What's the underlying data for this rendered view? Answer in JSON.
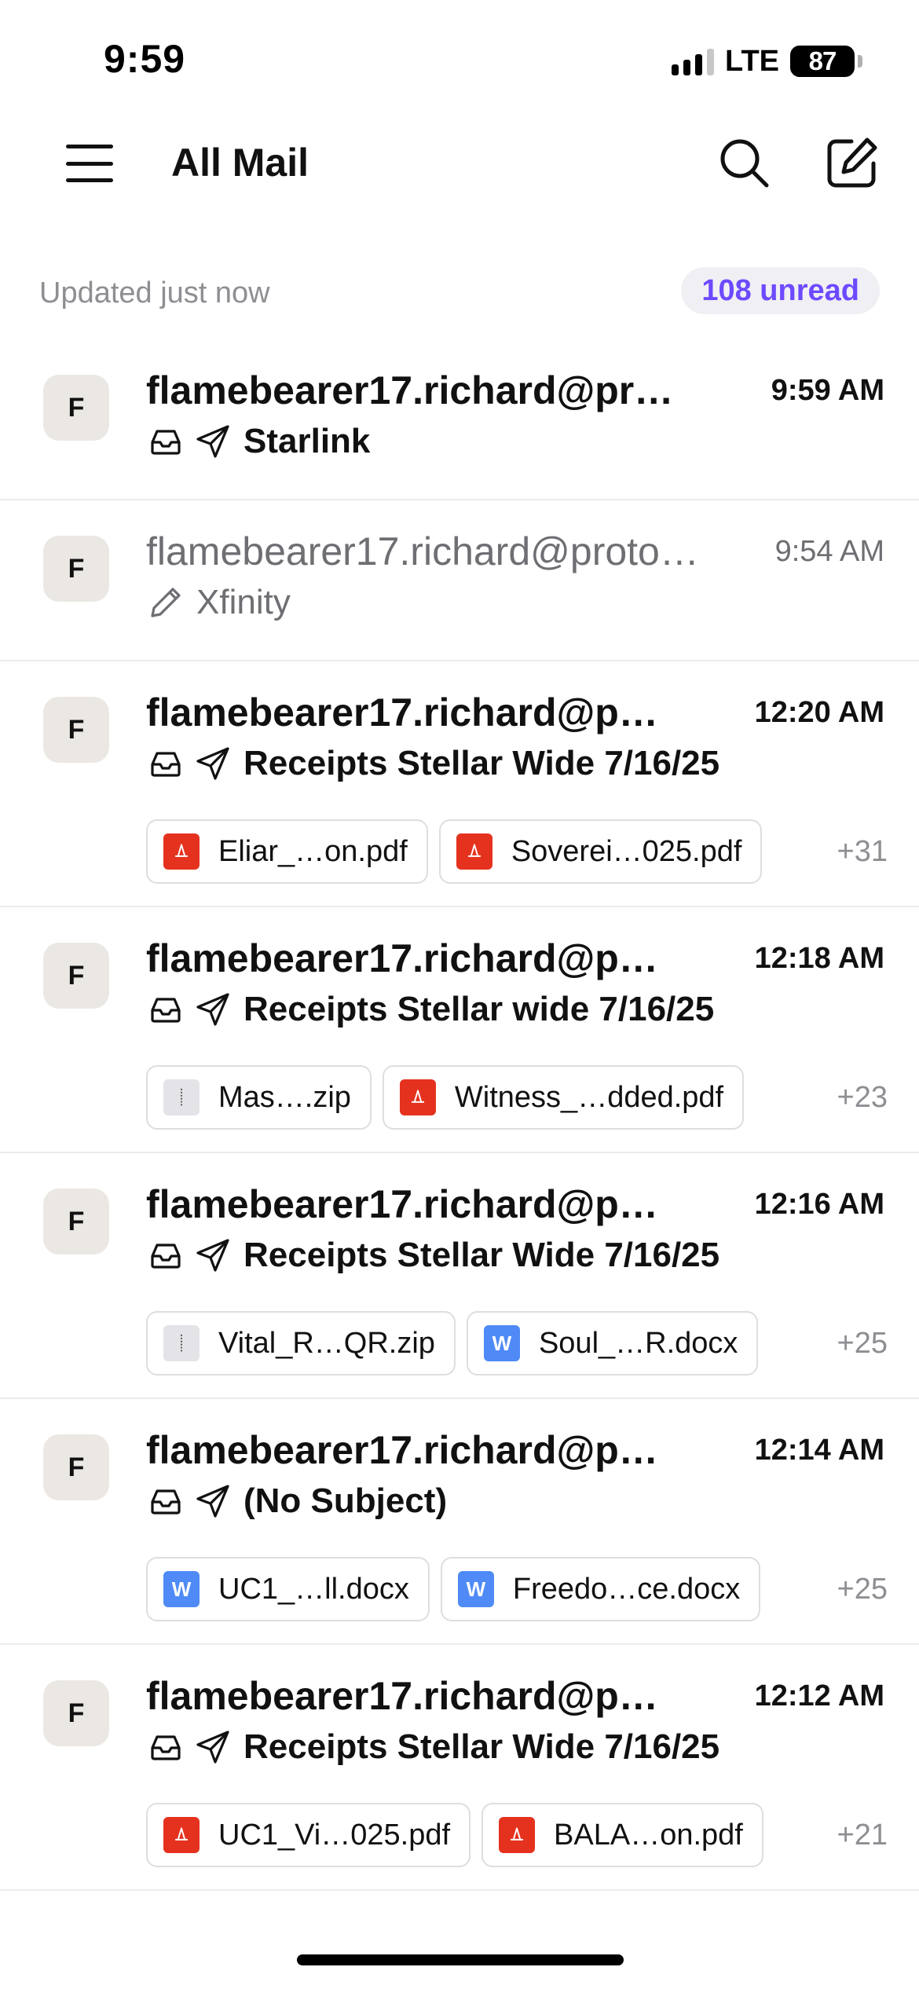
{
  "status_bar": {
    "time": "9:59",
    "network": "LTE",
    "battery": "87"
  },
  "header": {
    "title": "All Mail"
  },
  "sub_header": {
    "updated": "Updated just now",
    "unread": "108 unread"
  },
  "mails": [
    {
      "avatar": "F",
      "sender": "flamebearer17.richard@pr…",
      "time": "9:59 AM",
      "subject": "Starlink",
      "read": false,
      "icons": [
        "inbox-icon",
        "sent-icon"
      ],
      "attachments": [],
      "more": ""
    },
    {
      "avatar": "F",
      "sender": "flamebearer17.richard@proto…",
      "time": "9:54 AM",
      "subject": "Xfinity",
      "read": true,
      "icons": [
        "draft-pencil-icon"
      ],
      "attachments": [],
      "more": ""
    },
    {
      "avatar": "F",
      "sender": "flamebearer17.richard@p…",
      "time": "12:20 AM",
      "subject": "Receipts Stellar Wide 7/16/25",
      "read": false,
      "icons": [
        "inbox-icon",
        "sent-icon"
      ],
      "attachments": [
        {
          "type": "pdf",
          "name": "Eliar_…on.pdf"
        },
        {
          "type": "pdf",
          "name": "Soverei…025.pdf"
        }
      ],
      "more": "+31"
    },
    {
      "avatar": "F",
      "sender": "flamebearer17.richard@p…",
      "time": "12:18 AM",
      "subject": "Receipts Stellar wide 7/16/25",
      "read": false,
      "icons": [
        "inbox-icon",
        "sent-icon"
      ],
      "attachments": [
        {
          "type": "zip",
          "name": "Mas….zip"
        },
        {
          "type": "pdf",
          "name": "Witness_…dded.pdf"
        }
      ],
      "more": "+23"
    },
    {
      "avatar": "F",
      "sender": "flamebearer17.richard@p…",
      "time": "12:16 AM",
      "subject": "Receipts Stellar Wide 7/16/25",
      "read": false,
      "icons": [
        "inbox-icon",
        "sent-icon"
      ],
      "attachments": [
        {
          "type": "zip",
          "name": "Vital_R…QR.zip"
        },
        {
          "type": "doc",
          "name": "Soul_…R.docx"
        }
      ],
      "more": "+25"
    },
    {
      "avatar": "F",
      "sender": "flamebearer17.richard@p…",
      "time": "12:14 AM",
      "subject": "(No Subject)",
      "read": false,
      "icons": [
        "inbox-icon",
        "sent-icon"
      ],
      "attachments": [
        {
          "type": "doc",
          "name": "UC1_…ll.docx"
        },
        {
          "type": "doc",
          "name": "Freedo…ce.docx"
        }
      ],
      "more": "+25"
    },
    {
      "avatar": "F",
      "sender": "flamebearer17.richard@p…",
      "time": "12:12 AM",
      "subject": "Receipts Stellar Wide 7/16/25",
      "read": false,
      "icons": [
        "inbox-icon",
        "sent-icon"
      ],
      "attachments": [
        {
          "type": "pdf",
          "name": "UC1_Vi…025.pdf"
        },
        {
          "type": "pdf",
          "name": "BALA…on.pdf"
        }
      ],
      "more": "+21"
    }
  ],
  "file_type_letters": {
    "doc": "W"
  },
  "colors": {
    "accent": "#6d4aff",
    "pdf": "#e5321f",
    "docx": "#4f8af6",
    "unread_badge_bg": "#f0eff4"
  }
}
